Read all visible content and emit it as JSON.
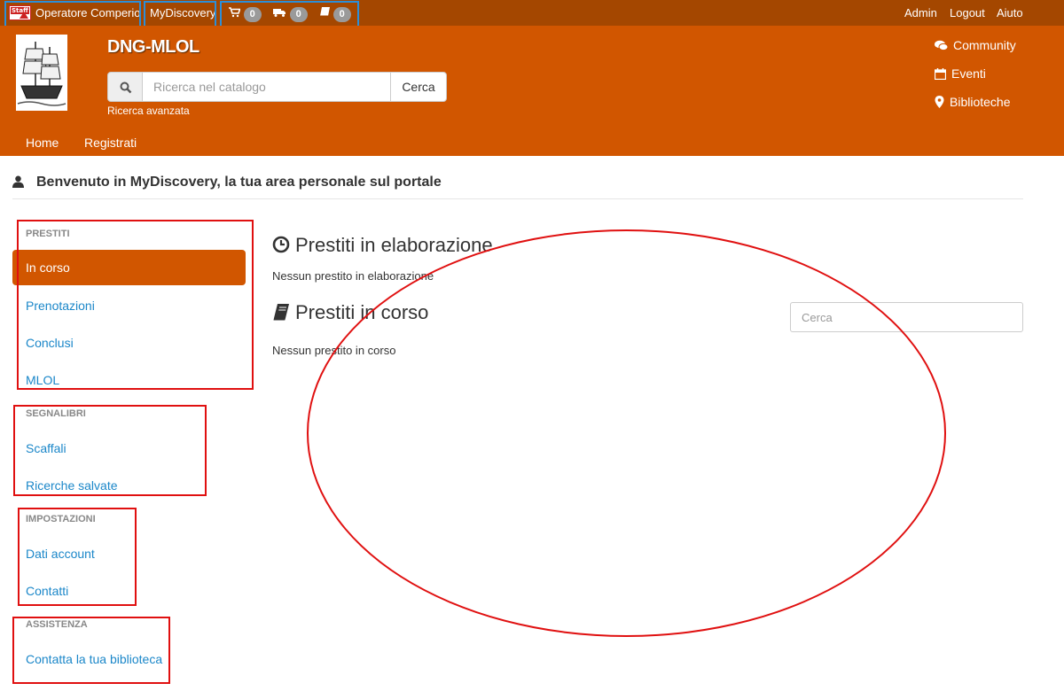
{
  "topbar": {
    "staff_logo_text": "Staff",
    "operator": "Operatore Comperio",
    "mydiscovery": "MyDiscovery",
    "cart_count": "0",
    "truck_count": "0",
    "book_count": "0",
    "admin": "Admin",
    "logout": "Logout",
    "help": "Aiuto"
  },
  "header": {
    "title": "DNG-MLOL",
    "search_placeholder": "Ricerca nel catalogo",
    "search_button": "Cerca",
    "advanced_search": "Ricerca avanzata",
    "links": {
      "community": "Community",
      "events": "Eventi",
      "libraries": "Biblioteche"
    },
    "nav": {
      "home": "Home",
      "register": "Registrati"
    }
  },
  "welcome": "Benvenuto in MyDiscovery, la tua area personale sul portale",
  "sidebar": {
    "loans": {
      "title": "PRESTITI",
      "active": "In corso",
      "reservations": "Prenotazioni",
      "concluded": "Conclusi",
      "mlol": "MLOL"
    },
    "bookmarks": {
      "title": "SEGNALIBRI",
      "shelves": "Scaffali",
      "saved_searches": "Ricerche salvate"
    },
    "settings": {
      "title": "IMPOSTAZIONI",
      "account": "Dati account",
      "contacts": "Contatti"
    },
    "support": {
      "title": "ASSISTENZA",
      "contact_library": "Contatta la tua biblioteca"
    }
  },
  "main": {
    "processing_title": "Prestiti in elaborazione",
    "processing_empty": "Nessun prestito in elaborazione",
    "current_title": "Prestiti in corso",
    "current_empty": "Nessun prestito in corso",
    "filter_placeholder": "Cerca"
  },
  "colors": {
    "topbar": "#a44700",
    "header": "#d15600",
    "link": "#1b87c9",
    "annotation_red": "#e01010",
    "annotation_blue": "#2b8fd9"
  }
}
